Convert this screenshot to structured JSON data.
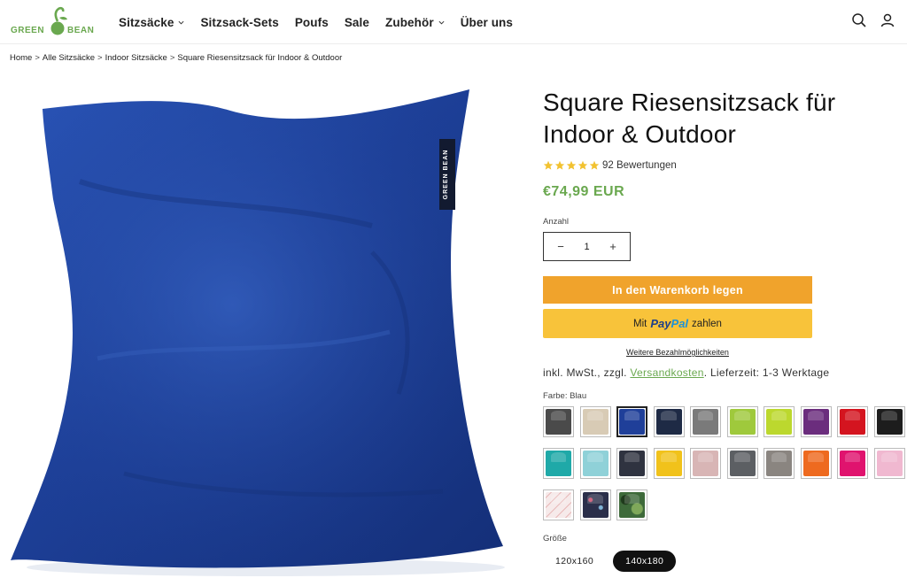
{
  "header": {
    "brand": "GREEN BEAN",
    "nav": [
      {
        "label": "Sitzsäcke",
        "dropdown": true
      },
      {
        "label": "Sitzsack-Sets",
        "dropdown": false
      },
      {
        "label": "Poufs",
        "dropdown": false
      },
      {
        "label": "Sale",
        "dropdown": false
      },
      {
        "label": "Zubehör",
        "dropdown": true
      },
      {
        "label": "Über uns",
        "dropdown": false
      }
    ],
    "icons": [
      "search-icon",
      "account-icon"
    ]
  },
  "breadcrumb": [
    "Home",
    "Alle Sitzsäcke",
    "Indoor Sitzsäcke",
    "Square Riesensitzsack für Indoor & Outdoor"
  ],
  "product": {
    "title": "Square Riesensitzsack für Indoor & Outdoor",
    "rating_stars": 5,
    "reviews": "92 Bewertungen",
    "price": "€74,99 EUR",
    "quantity_label": "Anzahl",
    "quantity_value": "1",
    "add_to_cart": "In den Warenkorb legen",
    "paypal_prefix": "Mit",
    "paypal_pay": "Pay",
    "paypal_pal": "Pal",
    "paypal_suffix": "zahlen",
    "more_payment": "Weitere Bezahlmöglichkeiten",
    "tax_prefix": "inkl. MwSt., zzgl.",
    "tax_link": "Versandkosten",
    "tax_suffix": ". Lieferzeit: 1-3 Werktage",
    "color_label": "Farbe: Blau",
    "size_label": "Größe",
    "sizes": [
      {
        "label": "120x160",
        "active": false
      },
      {
        "label": "140x180",
        "active": true
      }
    ],
    "bag_label": "GREEN BEAN"
  },
  "colors": {
    "accent_green": "#6aa84f",
    "cart_orange": "#f0a32c",
    "paypal_yellow": "#f8c33a",
    "product_blue": "#1d3f97"
  },
  "swatches": [
    {
      "name": "anthrazit",
      "color": "#4a4a4a",
      "selected": false
    },
    {
      "name": "beige",
      "color": "#d8cbb5",
      "selected": false
    },
    {
      "name": "blau",
      "color": "#1f3f99",
      "selected": true
    },
    {
      "name": "navy",
      "color": "#1e2a45",
      "selected": false
    },
    {
      "name": "grau",
      "color": "#7a7a7a",
      "selected": false
    },
    {
      "name": "lime",
      "color": "#9fc93c",
      "selected": false
    },
    {
      "name": "apfelgruen",
      "color": "#bcd82e",
      "selected": false
    },
    {
      "name": "lila",
      "color": "#6b2d7d",
      "selected": false
    },
    {
      "name": "rot",
      "color": "#d4141f",
      "selected": false
    },
    {
      "name": "schwarz",
      "color": "#1d1d1d",
      "selected": false
    },
    {
      "name": "tuerkis",
      "color": "#1fa9a8",
      "selected": false
    },
    {
      "name": "hellblau",
      "color": "#8fd1d8",
      "selected": false
    },
    {
      "name": "dunkelgrau",
      "color": "#2f3340",
      "selected": false
    },
    {
      "name": "gelb",
      "color": "#f1c21b",
      "selected": false
    },
    {
      "name": "rosa-grau",
      "color": "#d8b5b5",
      "selected": false
    },
    {
      "name": "graphit",
      "color": "#5c5f63",
      "selected": false
    },
    {
      "name": "taupe",
      "color": "#8a8580",
      "selected": false
    },
    {
      "name": "orange",
      "color": "#ee6a1f",
      "selected": false
    },
    {
      "name": "pink",
      "color": "#e0136e",
      "selected": false
    },
    {
      "name": "rosa",
      "color": "#f0b8d0",
      "selected": false
    },
    {
      "name": "muster-rosa",
      "color": "#f2e6e6",
      "selected": false
    },
    {
      "name": "muster-navy",
      "color": "#2b2f4a",
      "selected": false
    },
    {
      "name": "camouflage",
      "color": "#3e6a3a",
      "selected": false
    }
  ]
}
